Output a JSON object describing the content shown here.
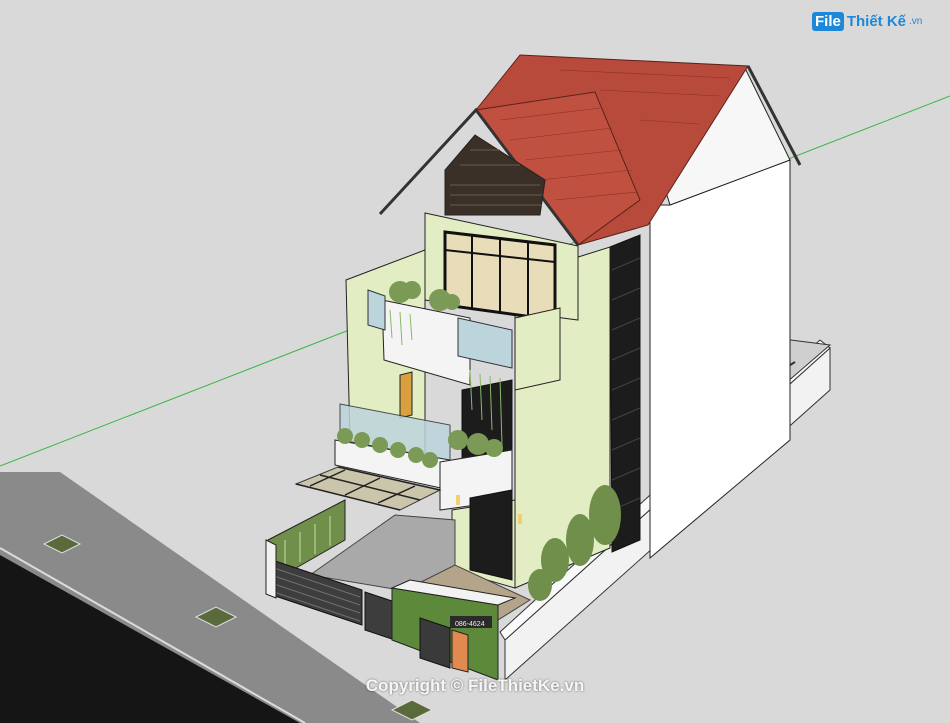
{
  "logo": {
    "badge": "File",
    "name": "Thiết Kế",
    "ext": ".vn"
  },
  "watermark": "Copyright © FileThietKe.vn",
  "house_sign": "086-4624",
  "colors": {
    "ground": "#d9d9d9",
    "street": "#8a8a8a",
    "road": "#151515",
    "roof": "#b84a3c",
    "wall": "#ffffff",
    "accent_wall": "#e3edc4",
    "glass": "#bcd4dc",
    "plant": "#7a9a55",
    "gate": "#3d3d3d",
    "axis_green": "#3ab54a"
  }
}
